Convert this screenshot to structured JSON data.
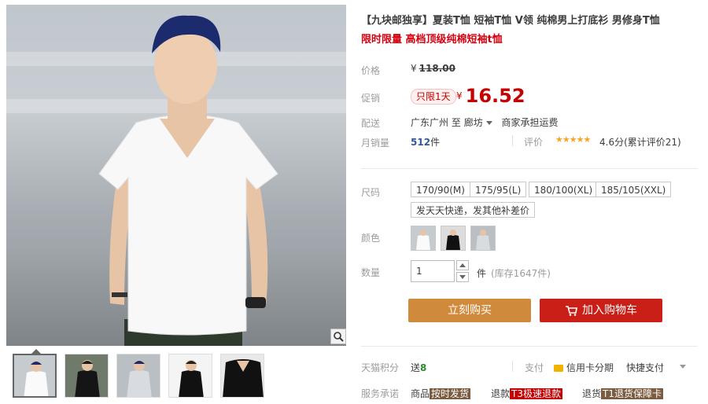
{
  "product": {
    "title": "【九块邮独享】夏装T恤 短袖T恤 V领 纯棉男上打底衫 男修身T恤",
    "subtitle": "限时限量 高档顶级纯棉短袖t恤"
  },
  "price": {
    "label": "价格",
    "currency": "¥",
    "original": "118.00"
  },
  "promo": {
    "label": "促销",
    "tag": "只限1天",
    "currency": "¥",
    "price": "16.52"
  },
  "shipping": {
    "label": "配送",
    "from": "广东广州",
    "to_word": "至",
    "dest": "廊坊",
    "fee": "商家承担运费"
  },
  "sales": {
    "label": "月销量",
    "count": "512",
    "unit": "件",
    "rating_label": "评价",
    "stars": "★★★★★",
    "rating_text": "4.6分(累计评价21)"
  },
  "size": {
    "label": "尺码",
    "options": [
      "170/90(M)",
      "175/95(L)",
      "180/100(XL)",
      "185/105(XXL)",
      "发天天快递，发其他补差价"
    ]
  },
  "color": {
    "label": "颜色"
  },
  "quantity": {
    "label": "数量",
    "value": "1",
    "unit": "件",
    "stock": "(库存1647件)"
  },
  "actions": {
    "buy_now": "立刻购买",
    "add_cart": "加入购物车"
  },
  "points": {
    "label": "天猫积分",
    "prefix": "送",
    "value": "8",
    "pay_label": "支付",
    "credit": "信用卡分期",
    "quick": "快捷支付"
  },
  "service": {
    "label": "服务承诺",
    "goods": "商品",
    "goods_tag": "按时发货",
    "refund": "退款",
    "refund_tag": "T3极速退款",
    "return": "退货",
    "return_tag": "T1退货保障卡"
  },
  "colors": {
    "accent_red": "#c40000",
    "buy_orange": "#d08a3c",
    "cart_red": "#c91f16"
  }
}
